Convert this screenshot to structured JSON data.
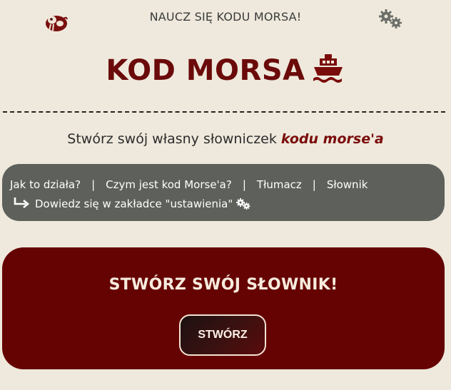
{
  "header": {
    "logo_icon": "walrus-icon",
    "title": "NAUCZ SIĘ KODU MORSA!",
    "settings_icon": "gears-icon"
  },
  "hero": {
    "title": "KOD MORSA",
    "icon": "ship-icon",
    "brand_color": "#6B0A0A"
  },
  "subtitle": {
    "text": "Stwórz swój własny słowniczek ",
    "emphasis": "kodu morse'a"
  },
  "nav": {
    "links": [
      "Jak to działa?",
      "Czym jest kod Morse'a?",
      "Tłumacz",
      "Słownik"
    ],
    "separator": "|",
    "hint": "Dowiedz się w zakładce \"ustawienia\"",
    "hint_icon": "arrow-turn-icon",
    "hint_gear_icon": "gears-icon",
    "background": "#5E605B"
  },
  "cta": {
    "title": "STWÓRZ SWÓJ SŁOWNIK!",
    "button_label": "STWÓRZ",
    "background": "#650202"
  }
}
